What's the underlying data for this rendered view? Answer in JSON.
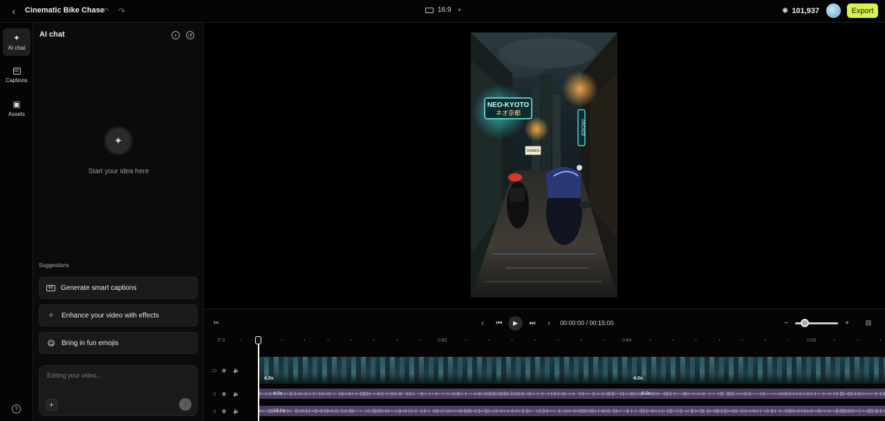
{
  "header": {
    "title": "Cinematic Bike Chase",
    "aspect_ratio": "16:9",
    "credits": "101,937",
    "export_label": "Export"
  },
  "rail": {
    "items": [
      {
        "label": "AI chat",
        "icon": "sparkle-icon"
      },
      {
        "label": "Captions",
        "icon": "captions-icon"
      },
      {
        "label": "Assets",
        "icon": "box-icon"
      }
    ]
  },
  "chat": {
    "title": "AI chat",
    "empty_state": "Start your idea here",
    "suggestions_label": "Suggestions",
    "suggestions": [
      {
        "label": "Generate smart captions",
        "icon": "cc-icon"
      },
      {
        "label": "Enhance your video with effects",
        "icon": "sparkle-icon"
      },
      {
        "label": "Bring in fun emojis",
        "icon": "emoji-icon"
      }
    ],
    "input_placeholder": "Editing your video..."
  },
  "preview": {
    "signs": {
      "neo": "NEO-KYOTO",
      "neo_jp": "ネオ京都",
      "arcade": "ARCADE",
      "ramen": "RAMEN"
    }
  },
  "transport": {
    "timecode": "00:00:00 / 00:15:00"
  },
  "timeline": {
    "frame_label": "F 0",
    "ruler_labels": [
      "0:02",
      "0:04",
      "0:06"
    ],
    "video_clips": [
      "4.0s",
      "4.0s"
    ],
    "audio1_clips": [
      "4.0s",
      "4.0s"
    ],
    "audio2_clip": "15.0s"
  },
  "colors": {
    "accent": "#d8f34a",
    "audio_track": "#4b3e5e"
  }
}
